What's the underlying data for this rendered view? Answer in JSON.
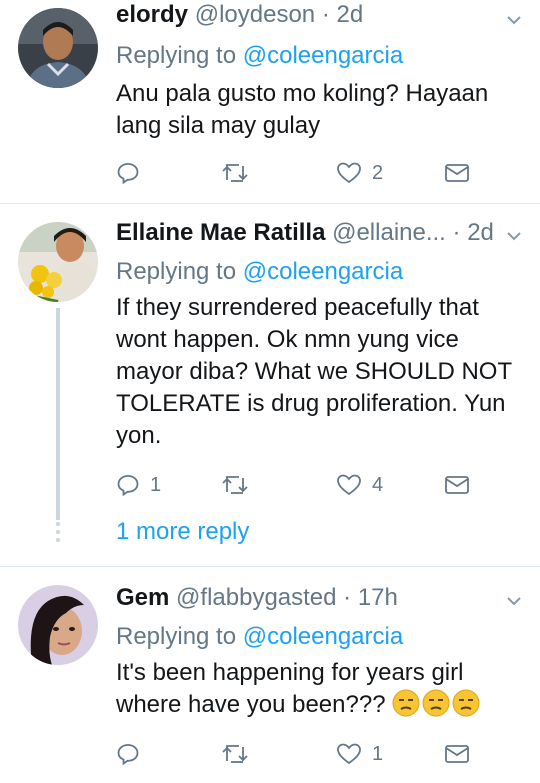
{
  "tweets": [
    {
      "name": "elordy",
      "handle": "@loydeson",
      "time": "· 2d",
      "replying_prefix": "Replying to ",
      "replying_to": "@coleengarcia",
      "body": "Anu pala gusto mo koling? Hayaan lang sila may gulay",
      "replies": "",
      "retweets": "",
      "likes": "2"
    },
    {
      "name": "Ellaine Mae Ratilla",
      "handle": "@ellaine...",
      "time": "· 2d",
      "replying_prefix": "Replying to ",
      "replying_to": "@coleengarcia",
      "body": "If they surrendered peacefully that wont happen. Ok nmn yung vice mayor diba? What we SHOULD NOT TOLERATE is drug proliferation. Yun yon.",
      "replies": "1",
      "retweets": "",
      "likes": "4",
      "more_replies": "1 more reply"
    },
    {
      "name": "Gem",
      "handle": "@flabbygasted",
      "time": "· 17h",
      "replying_prefix": "Replying to ",
      "replying_to": "@coleengarcia",
      "body": "It's been happening for years girl where have you been???",
      "emojis": [
        "unamused-face",
        "unamused-face",
        "unamused-face"
      ],
      "replies": "",
      "retweets": "",
      "likes": "1"
    }
  ],
  "colors": {
    "link": "#1da1f2",
    "secondary": "#657786",
    "divider": "#e1e8ed",
    "thread": "#ccd6dd"
  }
}
